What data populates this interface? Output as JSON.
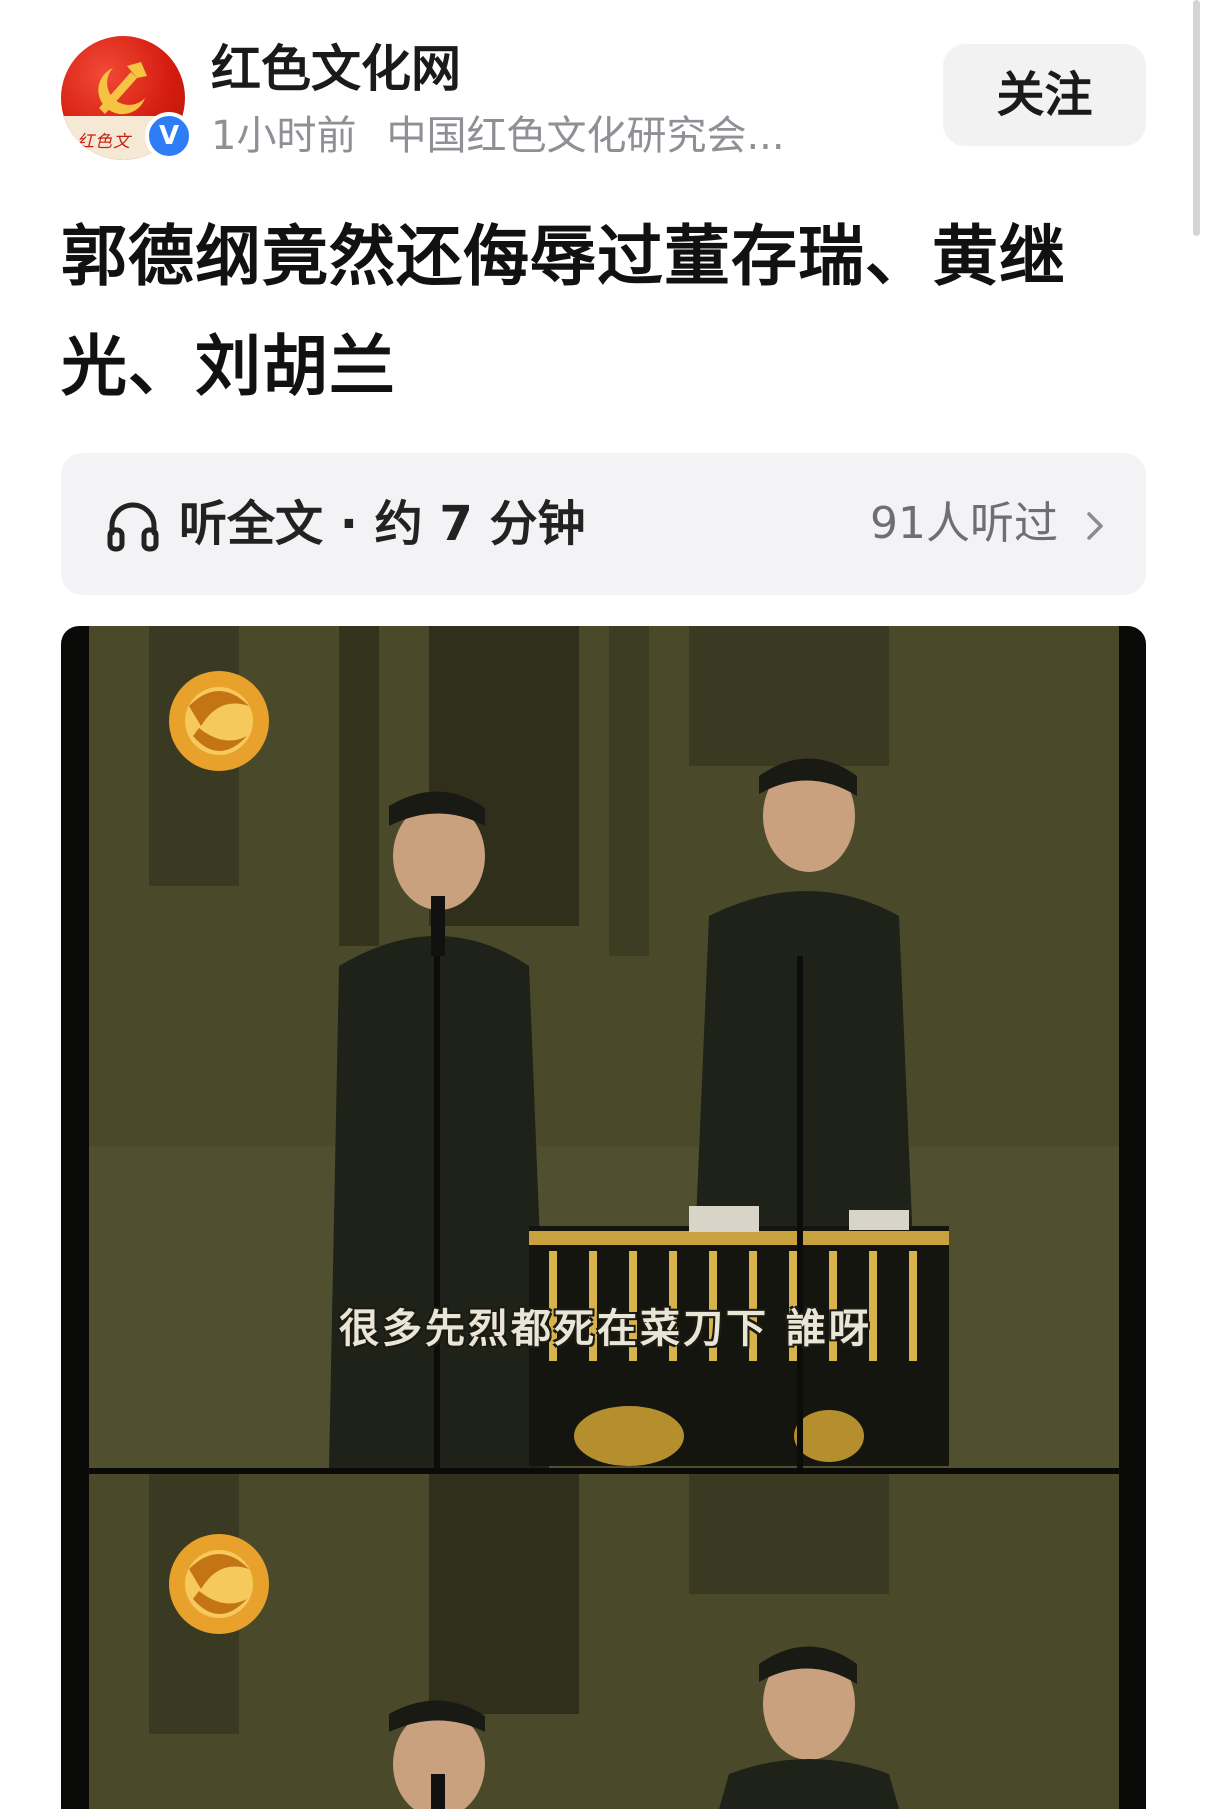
{
  "author": {
    "name": "红色文化网",
    "time": "1小时前",
    "org": "中国红色文化研究会...",
    "avatar_text": "红色文",
    "verified_mark": "V",
    "follow_label": "关注"
  },
  "article": {
    "title": "郭德纲竟然还侮辱过董存瑞、黄继光、刘胡兰"
  },
  "listen": {
    "label": "听全文 · 约 7 分钟",
    "count": "91人听过",
    "icon": "headphones-icon",
    "chevron_icon": "chevron-right-icon"
  },
  "image": {
    "subtitle": "很多先烈都死在菜刀下 誰呀",
    "frames": 2
  },
  "colors": {
    "accent_verified": "#2e7cf6",
    "follow_bg": "#f2f2f3",
    "listen_bg": "#f3f3f5",
    "meta_text": "#8f8f96"
  }
}
